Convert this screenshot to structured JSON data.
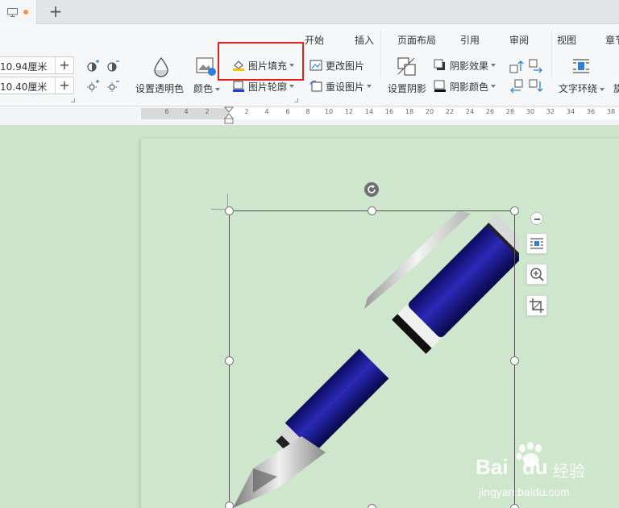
{
  "tabbar": {
    "new_tab": "+"
  },
  "menu": [
    {
      "label": "开始"
    },
    {
      "label": "插入"
    },
    {
      "label": "页面布局"
    },
    {
      "label": "引用"
    },
    {
      "label": "审阅"
    },
    {
      "label": "视图"
    },
    {
      "label": "章节"
    }
  ],
  "size": {
    "width": "10.94厘米",
    "height": "10.40厘米",
    "plus": "+"
  },
  "tools": {
    "transparent": "设置透明色",
    "color": "颜色",
    "picture_fill": "图片填充",
    "picture_outline": "图片轮廓",
    "change_picture": "更改图片",
    "reset_picture": "重设图片",
    "shadow": "设置阴影",
    "shadow_effect": "阴影效果",
    "shadow_color": "阴影颜色",
    "text_wrap": "文字环绕",
    "rotate_cut": "旋"
  },
  "ruler": [
    "6",
    "4",
    "2",
    "2",
    "4",
    "6",
    "8",
    "10",
    "12",
    "14",
    "16",
    "18",
    "20",
    "22",
    "24",
    "26",
    "28",
    "30",
    "32",
    "34",
    "36",
    "38"
  ],
  "watermark": {
    "brand": "Bai",
    "brand2": "du",
    "cn": "经验",
    "url": "jingyan.baidu.com"
  },
  "colors": {
    "accent_dot": "#f09a3e",
    "highlight": "#e32019",
    "pen_body": "#1a1a8c",
    "page_bg": "#cee6cc"
  }
}
